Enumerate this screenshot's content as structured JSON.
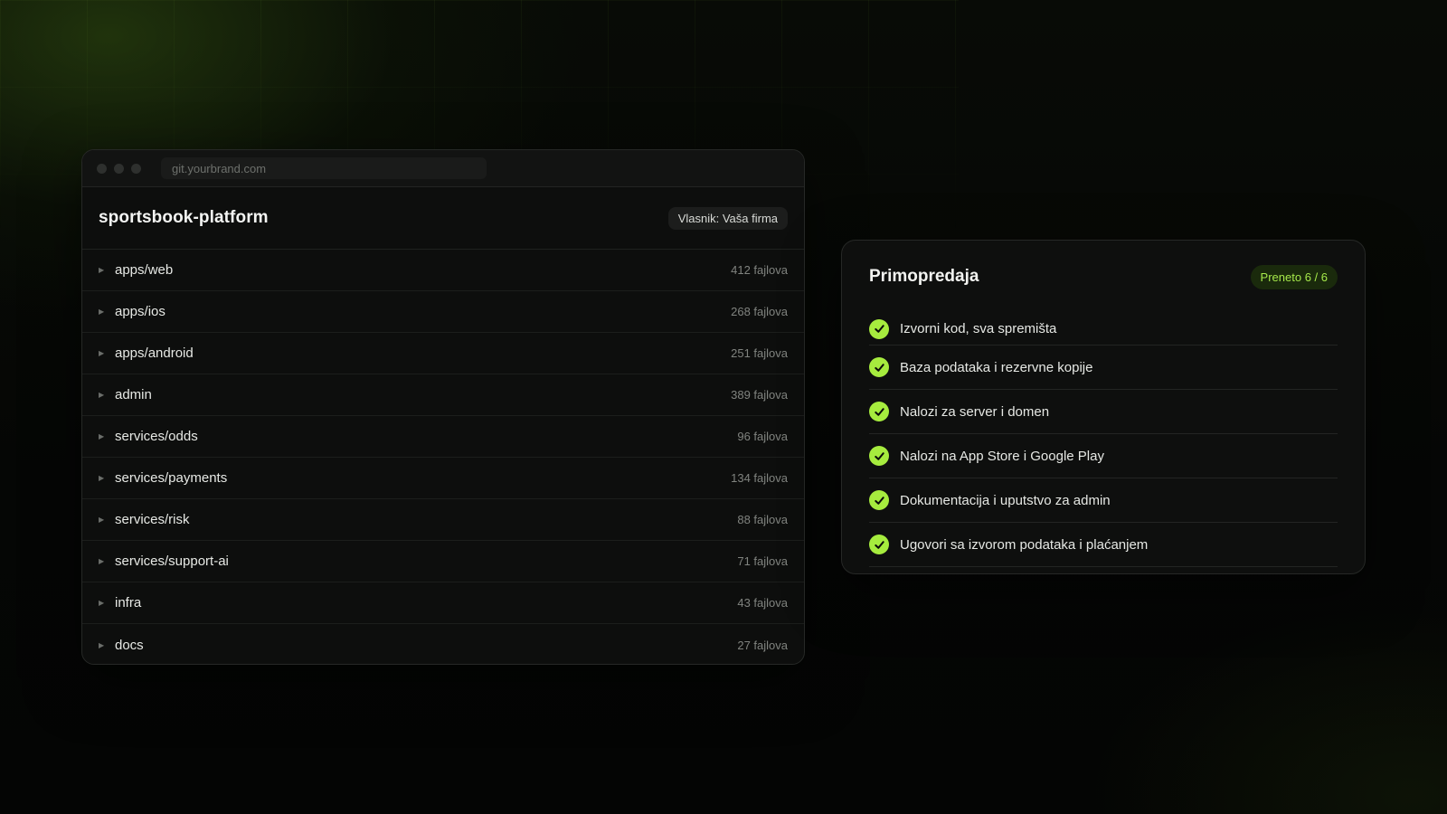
{
  "window": {
    "url": "git.yourbrand.com"
  },
  "repo": {
    "title": "sportsbook-platform",
    "owner_badge": "Vlasnik: Vaša firma",
    "rows": [
      {
        "name": "apps/web",
        "count": "412 fajlova"
      },
      {
        "name": "apps/ios",
        "count": "268 fajlova"
      },
      {
        "name": "apps/android",
        "count": "251 fajlova"
      },
      {
        "name": "admin",
        "count": "389 fajlova"
      },
      {
        "name": "services/odds",
        "count": "96 fajlova"
      },
      {
        "name": "services/payments",
        "count": "134 fajlova"
      },
      {
        "name": "services/risk",
        "count": "88 fajlova"
      },
      {
        "name": "services/support-ai",
        "count": "71 fajlova"
      },
      {
        "name": "infra",
        "count": "43 fajlova"
      },
      {
        "name": "docs",
        "count": "27 fajlova"
      }
    ]
  },
  "handover": {
    "title": "Primopredaja",
    "status": "Preneto 6 / 6",
    "items": [
      {
        "label": "Izvorni kod, sva spremišta"
      },
      {
        "label": "Baza podataka i rezervne kopije"
      },
      {
        "label": "Nalozi za server i domen"
      },
      {
        "label": "Nalozi na App Store i Google Play"
      },
      {
        "label": "Dokumentacija i uputstvo za admin"
      },
      {
        "label": "Ugovori sa izvorom podataka i plaćanjem"
      }
    ]
  },
  "colors": {
    "accent": "#a6ec3e",
    "background": "#050605",
    "panel": "#0d0e0d"
  }
}
